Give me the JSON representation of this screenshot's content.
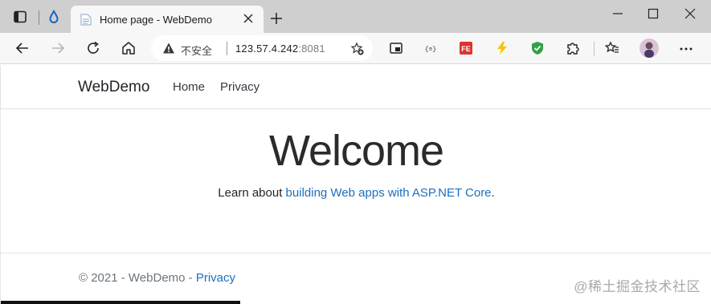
{
  "browser": {
    "tab": {
      "title": "Home page - WebDemo"
    },
    "address": {
      "security_label": "不安全",
      "host": "123.57.4.242",
      "port": ":8081"
    },
    "icons": [
      "tab-actions-icon",
      "drop-icon",
      "page-favicon-icon",
      "close-icon",
      "plus-icon",
      "minimize-icon",
      "maximize-icon",
      "window-close-icon",
      "back-icon",
      "forward-icon",
      "refresh-icon",
      "home-icon",
      "warning-icon",
      "add-favorite-icon",
      "pip-icon",
      "json-extension-icon",
      "fe-extension-icon",
      "lightning-extension-icon",
      "shield-extension-icon",
      "extensions-puzzle-icon",
      "favorites-icon",
      "avatar",
      "more-icon"
    ]
  },
  "navbar": {
    "brand": "WebDemo",
    "links": [
      "Home",
      "Privacy"
    ]
  },
  "main": {
    "heading": "Welcome",
    "lead_prefix": "Learn about ",
    "lead_link": "building Web apps with ASP.NET Core",
    "lead_suffix": "."
  },
  "footer": {
    "copyright": "© 2021 - WebDemo - ",
    "privacy_link": "Privacy"
  },
  "watermark": "@稀土掘金技术社区",
  "colors": {
    "link": "#1b6ec2",
    "text": "#212529",
    "muted": "#6c757d",
    "tabstrip": "#cfcfcf"
  }
}
